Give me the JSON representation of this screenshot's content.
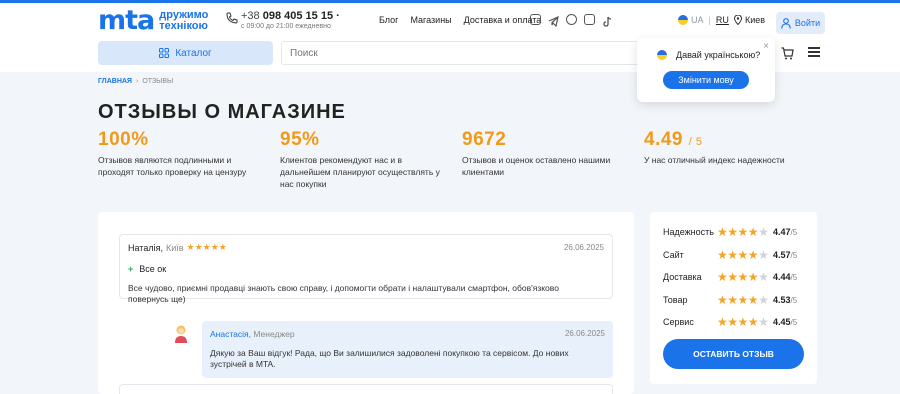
{
  "header": {
    "logo_mark": "mta",
    "logo_tagline_1": "дружимо",
    "logo_tagline_2": "технікою",
    "phone_prefix": "+38",
    "phone_number": "098 405 15 15",
    "phone_hours": "с 09:00 до 21:00 ежедневно",
    "nav": [
      "Блог",
      "Магазины",
      "Доставка и оплата"
    ],
    "socials": [
      "instagram-icon",
      "telegram-icon",
      "viber-icon",
      "youtube-icon",
      "tiktok-icon"
    ],
    "lang_ua": "UA",
    "lang_ru": "RU",
    "city": "Киев",
    "login": "Войти",
    "catalog": "Каталог",
    "search_placeholder": "Поиск"
  },
  "lang_popup": {
    "question": "Давай українською?",
    "button": "Змінити мову",
    "close": "×"
  },
  "breadcrumb": {
    "home": "ГЛАВНАЯ",
    "separator": "›",
    "current": "ОТЗЫВЫ"
  },
  "page_title": "ОТЗЫВЫ О МАГАЗИНЕ",
  "stats": [
    {
      "value": "100%",
      "suffix": "",
      "desc": "Отзывов являются подлинными и проходят только проверку на цензуру"
    },
    {
      "value": "95%",
      "suffix": "",
      "desc": "Клиентов рекомендуют нас и в дальнейшем планируют осуществлять у нас покупки"
    },
    {
      "value": "9672",
      "suffix": "",
      "desc": "Отзывов и оценок оставлено нашими клиентами"
    },
    {
      "value": "4.49",
      "suffix": "/ 5",
      "desc": "У нас отличный индекс надежности"
    }
  ],
  "review": {
    "author": "Наталія,",
    "city": "Київ",
    "stars": "★★★★★",
    "date": "26.06.2025",
    "plus_sign": "+",
    "plus_text": "Все ок",
    "text": "Все чудово, приємні продавці знають свою справу, і допомогти обрати і налаштували смартфон, обов'язково повернусь ще)"
  },
  "answer": {
    "author": "Анастасія,",
    "role": "Менеджер",
    "date": "26.06.2025",
    "text": "Дякую за Ваш відгук! Рада, що Ви залишилися задоволені покупкою та сервісом. До нових зустрічей в MTA."
  },
  "ratings": [
    {
      "label": "Надежность",
      "value": "4.47",
      "max": "/5",
      "score": 4.47
    },
    {
      "label": "Сайт",
      "value": "4.57",
      "max": "/5",
      "score": 4.57
    },
    {
      "label": "Доставка",
      "value": "4.44",
      "max": "/5",
      "score": 4.44
    },
    {
      "label": "Товар",
      "value": "4.53",
      "max": "/5",
      "score": 4.53
    },
    {
      "label": "Сервис",
      "value": "4.45",
      "max": "/5",
      "score": 4.45
    }
  ],
  "leave_review": "ОСТАВИТЬ ОТЗЫВ",
  "colors": {
    "accent": "#1a73e8",
    "stars": "#f3a52a",
    "stat": "#f19a1a",
    "plus": "#27ae60"
  }
}
